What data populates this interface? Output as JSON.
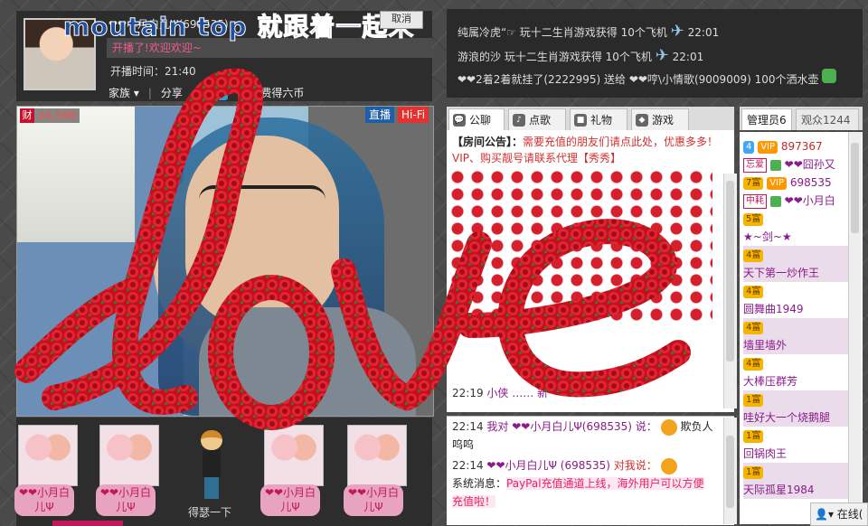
{
  "overlay": {
    "headline": "moutain top 就跟着一起来",
    "cancel_label": "取消"
  },
  "host": {
    "name": "❤❤小月白儿Ψ(698535)",
    "status_text": "开播了!欢迎欢迎~",
    "start_time_label": "开播时间：21:40",
    "actions": [
      "家族",
      "分享",
      "免费得六币"
    ]
  },
  "video": {
    "wealth_badge": "财",
    "wealth_count": "24,598",
    "live_badge": "直播",
    "hifi_badge": "Hi-Fi"
  },
  "gift_strip": {
    "labels": [
      "❤❤小月白儿Ψ",
      "❤❤小月白儿Ψ",
      "❤❤小月白儿Ψ",
      "❤❤小月白儿Ψ"
    ],
    "figure_label": "得瑟一下"
  },
  "ticker": [
    {
      "text": "纯属冷虎“☞ 玩十二生肖游戏获得  10个飞机",
      "time": "22:01"
    },
    {
      "text": "游浪的沙  玩十二生肖游戏获得  10个飞机",
      "time": "22:01"
    },
    {
      "text": "❤❤2着2着就挂了(2222995) 送给  ❤❤哼\\小情歌(9009009) 100个洒水壶",
      "time": ""
    }
  ],
  "chat_tabs": [
    "公聊",
    "点歌",
    "礼物",
    "游戏"
  ],
  "announcement": {
    "prefix": "【房间公告】：",
    "text": "需要充值的朋友们请点此处，优惠多多！  VIP、购买靓号请联系代理【秀秀】"
  },
  "chat_upper": [
    {
      "time": "22:19",
      "text": "小侠 …… 新"
    }
  ],
  "chat_lower": [
    {
      "time": "22:14",
      "text": "我对 ❤❤小月白儿Ψ(698535) 说：",
      "tail": "欺负人",
      "line2": "呜呜"
    },
    {
      "time": "22:14",
      "text": "❤❤小月白儿Ψ (698535)",
      "tail": "对我说："
    }
  ],
  "system_message": {
    "prefix": "系统消息：",
    "text": "PayPal充值通道上线，海外用户可以方便充值啦！"
  },
  "user_tabs": [
    "管理员6",
    "观众1244"
  ],
  "users": [
    {
      "level": "4",
      "badge": "VIP",
      "name": "897367"
    },
    {
      "level": "",
      "badge": "忘爱",
      "name": "❤❤囧孙又"
    },
    {
      "level": "7富",
      "badge": "VIP",
      "name": "698535"
    },
    {
      "level": "",
      "badge": "中耗",
      "name": "❤❤小月白"
    },
    {
      "level": "5富",
      "badge": "",
      "name": ""
    },
    {
      "level": "",
      "badge": "",
      "name": "★~剑~★"
    },
    {
      "level": "4富",
      "badge": "",
      "name": ""
    },
    {
      "level": "",
      "badge": "",
      "name": "天下第一炒作王"
    },
    {
      "level": "4富",
      "badge": "",
      "name": ""
    },
    {
      "level": "",
      "badge": "",
      "name": "圆舞曲1949"
    },
    {
      "level": "4富",
      "badge": "",
      "name": ""
    },
    {
      "level": "",
      "badge": "",
      "name": "墙里墙外"
    },
    {
      "level": "4富",
      "badge": "",
      "name": ""
    },
    {
      "level": "",
      "badge": "",
      "name": "大棒压群芳"
    },
    {
      "level": "1富",
      "badge": "",
      "name": ""
    },
    {
      "level": "",
      "badge": "",
      "name": "哇好大一个烧鹅腿"
    },
    {
      "level": "1富",
      "badge": "",
      "name": ""
    },
    {
      "level": "",
      "badge": "",
      "name": "回锅肉王"
    },
    {
      "level": "1富",
      "badge": "",
      "name": ""
    },
    {
      "level": "",
      "badge": "",
      "name": "天际孤星1984"
    }
  ],
  "online_label": "在线("
}
